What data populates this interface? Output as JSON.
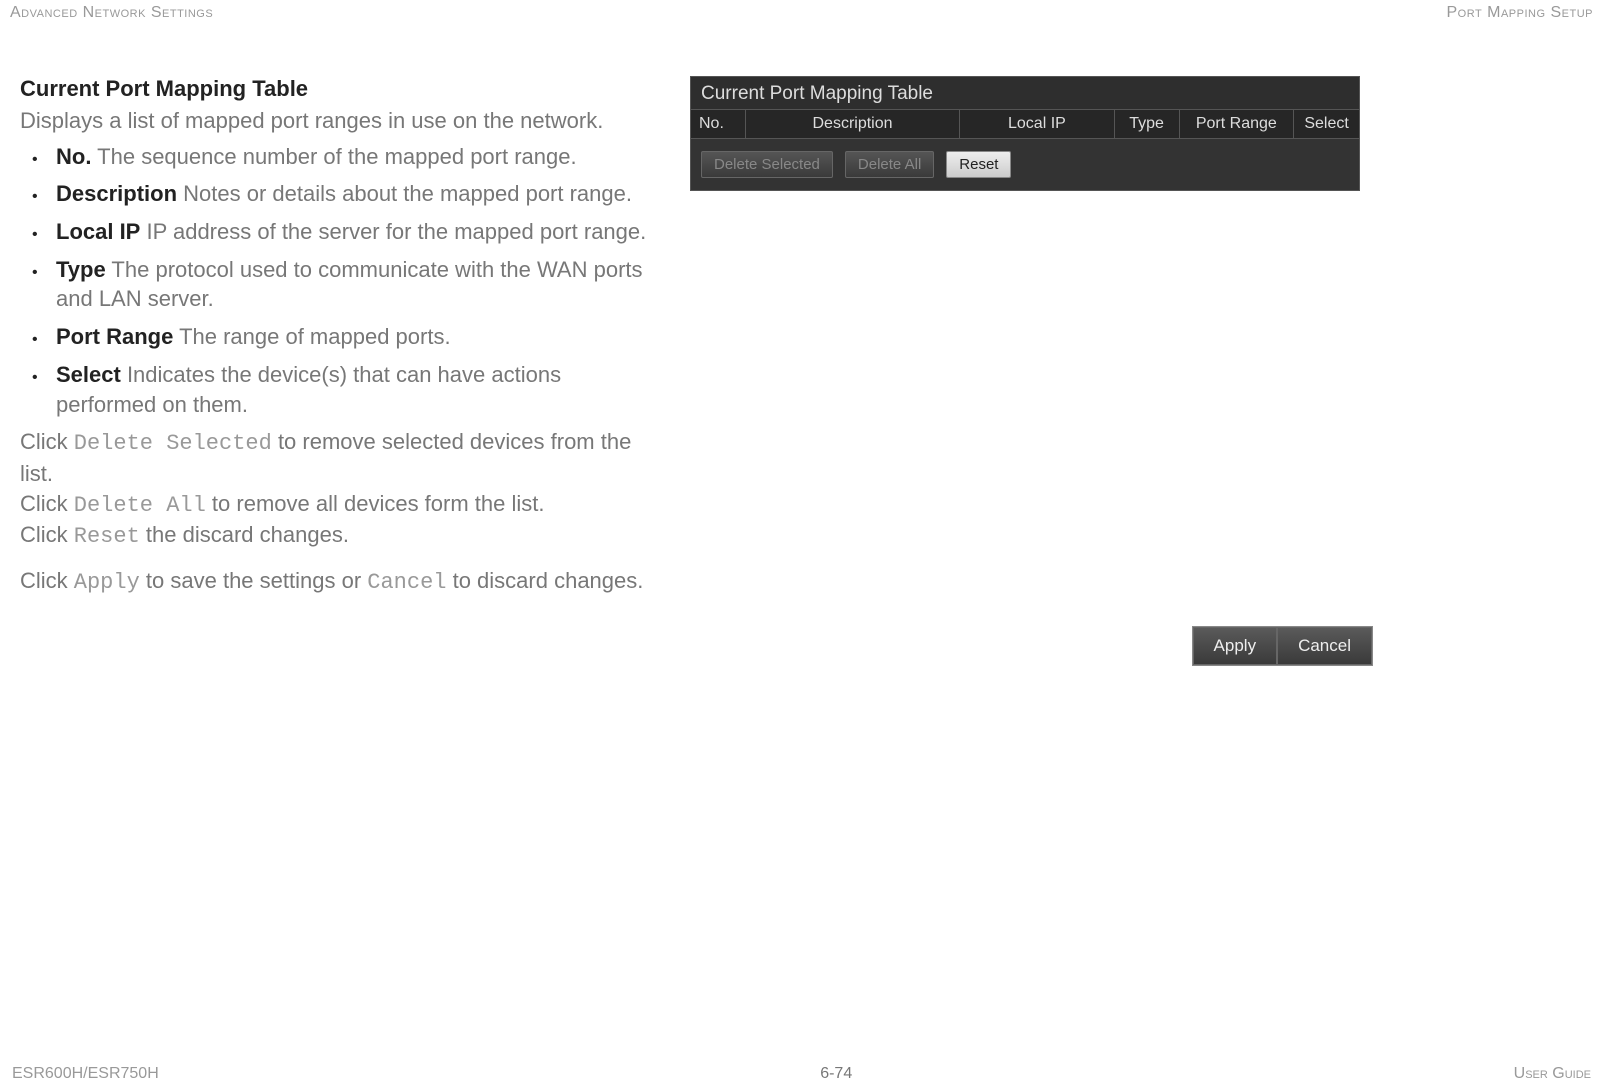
{
  "header": {
    "left": "Advanced Network Settings",
    "right": "Port Mapping Setup"
  },
  "section": {
    "title": "Current Port Mapping Table",
    "subtitle": "Displays a list of mapped port ranges in use on the network."
  },
  "bullets": [
    {
      "term": "No.",
      "desc": "  The sequence number of the mapped port range."
    },
    {
      "term": "Description",
      "desc": "  Notes or details about the mapped port range."
    },
    {
      "term": "Local IP",
      "desc": "  IP address of the server for the mapped port range."
    },
    {
      "term": "Type",
      "desc": "  The protocol used to communicate with the WAN ports and LAN server."
    },
    {
      "term": "Port Range",
      "desc": "  The range of mapped ports."
    },
    {
      "term": "Select",
      "desc": "  Indicates the device(s) that can have actions performed on them."
    }
  ],
  "actions": {
    "delete_selected_pre": "Click ",
    "delete_selected_cmd": "Delete Selected",
    "delete_selected_post": " to remove selected devices from the list.",
    "delete_all_pre": "Click ",
    "delete_all_cmd": "Delete All",
    "delete_all_post": " to remove all devices form the list.",
    "reset_pre": "Click ",
    "reset_cmd": "Reset",
    "reset_post": " the discard changes.",
    "apply_pre": "Click ",
    "apply_cmd": "Apply",
    "apply_mid": " to save the settings or ",
    "cancel_cmd": "Cancel",
    "apply_post": " to discard changes."
  },
  "panel": {
    "title": "Current Port Mapping Table",
    "columns": {
      "no": "No.",
      "desc": "Description",
      "local_ip": "Local IP",
      "type": "Type",
      "port_range": "Port Range",
      "select": "Select"
    },
    "buttons": {
      "delete_selected": "Delete Selected",
      "delete_all": "Delete All",
      "reset": "Reset"
    }
  },
  "apply_cancel": {
    "apply": "Apply",
    "cancel": "Cancel"
  },
  "footer": {
    "left": "ESR600H/ESR750H",
    "center": "6-74",
    "right": "User Guide"
  }
}
